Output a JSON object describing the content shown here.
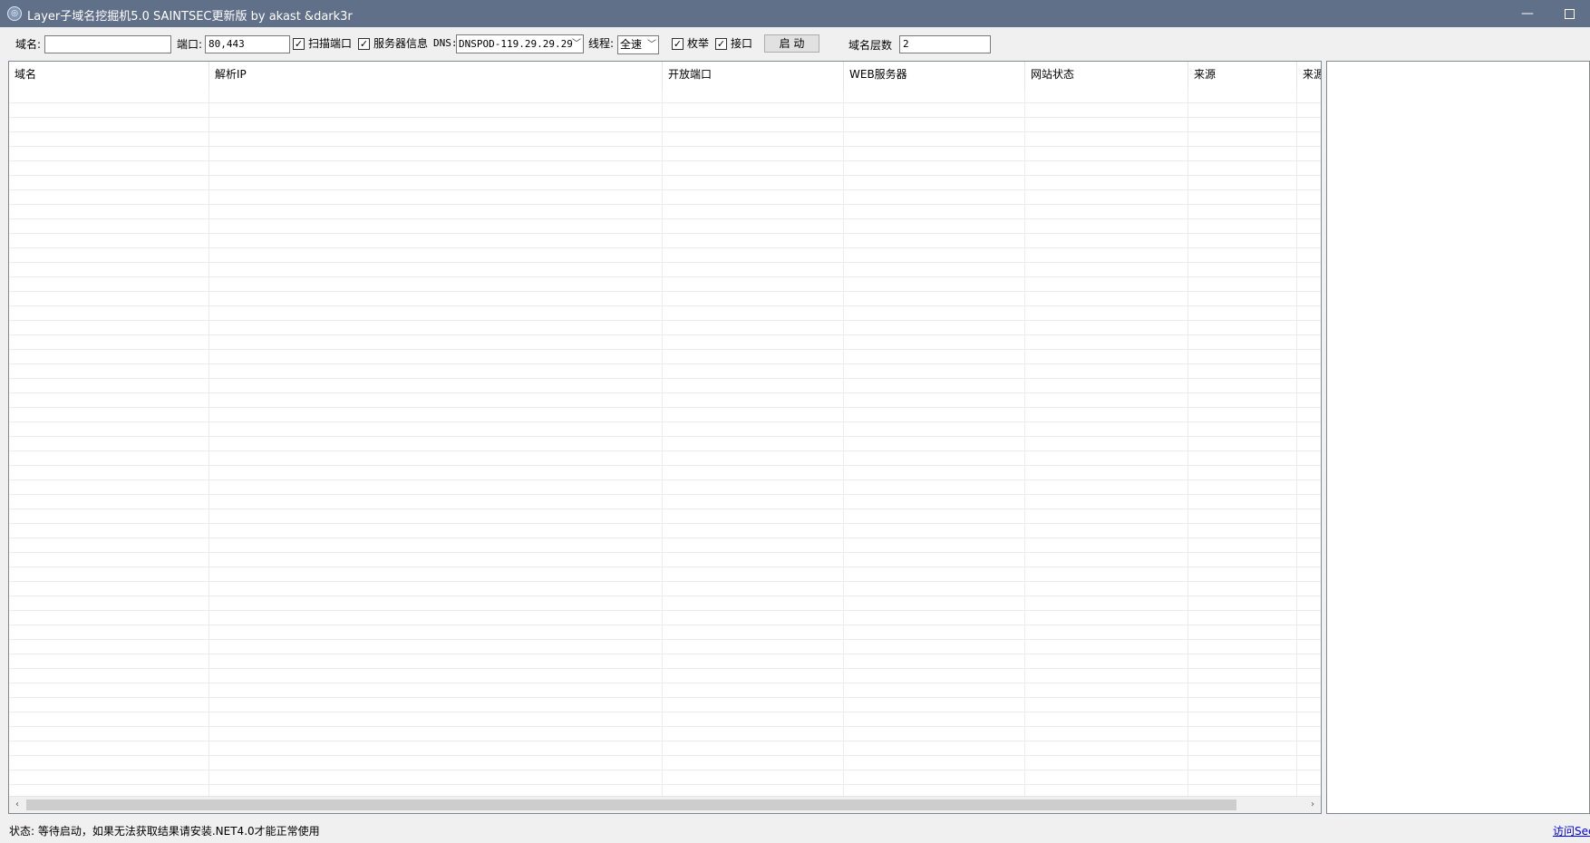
{
  "window": {
    "title": "Layer子域名挖掘机5.0 SAINTSEC更新版 by akast &dark3r",
    "icon": "app-globe-icon",
    "minimize_glyph": "—"
  },
  "toolbar": {
    "domain_label": "域名:",
    "domain_value": "",
    "port_label": "端口:",
    "port_value": "80,443",
    "scan_port_checked": "✓",
    "scan_port_label": "扫描端口",
    "server_info_checked": "✓",
    "server_info_label": "服务器信息",
    "dns_label": "DNS:",
    "dns_value": "DNSPOD-119.29.29.29",
    "thread_label": "线程:",
    "thread_value": "全速",
    "enum_checked": "✓",
    "enum_label": "枚举",
    "api_checked": "✓",
    "api_label": "接口",
    "start_label": "启 动",
    "depth_label": "域名层数",
    "depth_value": "2"
  },
  "table": {
    "columns": [
      "域名",
      "解析IP",
      "开放端口",
      "WEB服务器",
      "网站状态",
      "来源",
      "来源"
    ],
    "rows": []
  },
  "scrollbar": {
    "left_glyph": "‹",
    "right_glyph": "›"
  },
  "status": {
    "text": "状态: 等待启动，如果无法获取结果请安装.NET4.0才能正常使用",
    "link": "访问Sec"
  }
}
